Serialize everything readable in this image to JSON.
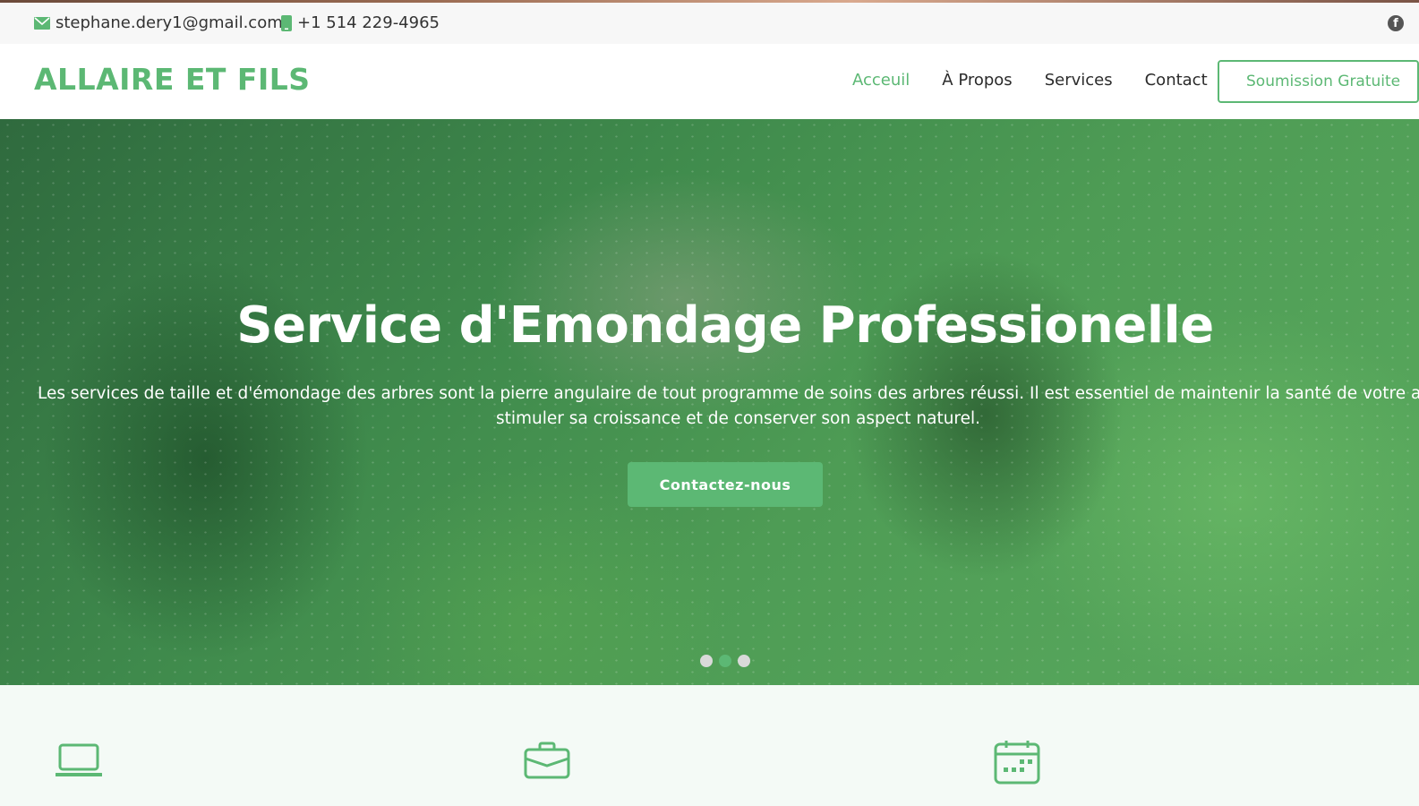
{
  "topbar": {
    "email": "stephane.dery1@gmail.com",
    "phone": "+1 514 229-4965",
    "email_icon": "envelope-icon",
    "phone_icon": "mobile-phone-icon",
    "social_icon": "facebook-icon"
  },
  "header": {
    "logo": "ALLAIRE ET FILS",
    "nav": [
      "Acceuil",
      "À Propos",
      "Services",
      "Contact"
    ],
    "active_nav": "Acceuil",
    "quote_button": "Soumission Gratuite"
  },
  "hero": {
    "title": "Service d'Emondage Professionelle",
    "text_line1": "Les services de taille et d'émondage des arbres sont la pierre angulaire de tout programme de soins des arbres réussi. Il est essentiel de maintenir la santé de votre arbre, d",
    "text_line2": "stimuler sa croissance et de conserver son aspect naturel.",
    "button": "Contactez-nous",
    "slides_count": 3,
    "active_slide": 2
  },
  "features": {
    "icons": [
      "laptop-icon",
      "briefcase-icon",
      "calendar-icon"
    ]
  },
  "colors": {
    "accent": "#5cb874",
    "topbar_bg": "#f7f7f7",
    "features_bg": "#f4faf6",
    "hero_overlay": "#3f8a4c"
  }
}
